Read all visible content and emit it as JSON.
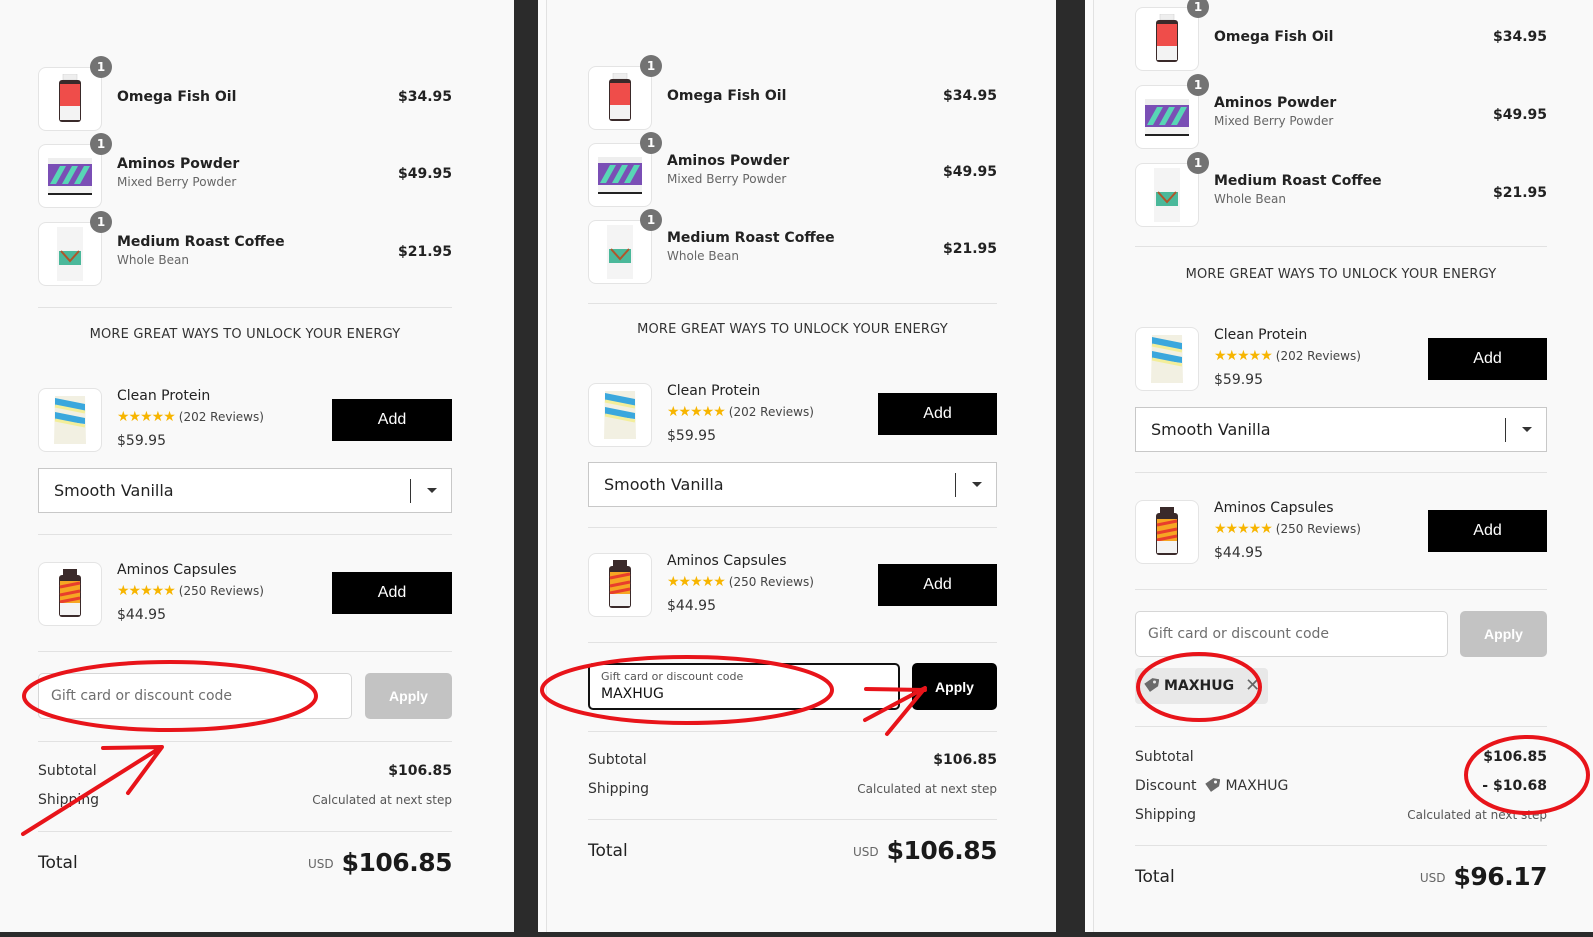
{
  "steps": [
    {
      "line_items": [
        {
          "name": "Omega Fish Oil",
          "variant": "",
          "price": "$34.95",
          "quantity": "1",
          "image": "red-bottle"
        },
        {
          "name": "Aminos Powder",
          "variant": "Mixed Berry Powder",
          "price": "$49.95",
          "quantity": "1",
          "image": "purple-teal-tub"
        },
        {
          "name": "Medium Roast Coffee",
          "variant": "Whole Bean",
          "price": "$21.95",
          "quantity": "1",
          "image": "white-coffee-bag"
        }
      ],
      "upsell_heading": "MORE GREAT WAYS TO UNLOCK YOUR ENERGY",
      "upsells": [
        {
          "name": "Clean Protein",
          "stars": "★★★★★",
          "rating": 5,
          "reviews": "(202 Reviews)",
          "price": "$59.95",
          "button": "Add",
          "variant_select": "Smooth Vanilla",
          "image": "blue-yellow-pouch"
        },
        {
          "name": "Aminos Capsules",
          "stars": "★★★★★",
          "rating": 5,
          "reviews": "(250 Reviews)",
          "price": "$44.95",
          "button": "Add",
          "image": "orange-bottle"
        }
      ],
      "discount": {
        "placeholder": "Gift card or discount code",
        "value": "",
        "apply_label": "Apply",
        "apply_state": "disabled"
      },
      "summary": {
        "subtotal_label": "Subtotal",
        "subtotal": "$106.85",
        "shipping_label": "Shipping",
        "shipping": "Calculated at next step",
        "total_label": "Total",
        "currency": "USD",
        "total": "$106.85"
      }
    },
    {
      "line_items": [
        {
          "name": "Omega Fish Oil",
          "variant": "",
          "price": "$34.95",
          "quantity": "1",
          "image": "red-bottle"
        },
        {
          "name": "Aminos Powder",
          "variant": "Mixed Berry Powder",
          "price": "$49.95",
          "quantity": "1",
          "image": "purple-teal-tub"
        },
        {
          "name": "Medium Roast Coffee",
          "variant": "Whole Bean",
          "price": "$21.95",
          "quantity": "1",
          "image": "white-coffee-bag"
        }
      ],
      "upsell_heading": "MORE GREAT WAYS TO UNLOCK YOUR ENERGY",
      "upsells": [
        {
          "name": "Clean Protein",
          "stars": "★★★★★",
          "rating": 5,
          "reviews": "(202 Reviews)",
          "price": "$59.95",
          "button": "Add",
          "variant_select": "Smooth Vanilla",
          "image": "blue-yellow-pouch"
        },
        {
          "name": "Aminos Capsules",
          "stars": "★★★★★",
          "rating": 5,
          "reviews": "(250 Reviews)",
          "price": "$44.95",
          "button": "Add",
          "image": "orange-bottle"
        }
      ],
      "discount": {
        "placeholder": "Gift card or discount code",
        "value": "MAXHUG",
        "apply_label": "Apply",
        "apply_state": "active"
      },
      "summary": {
        "subtotal_label": "Subtotal",
        "subtotal": "$106.85",
        "shipping_label": "Shipping",
        "shipping": "Calculated at next step",
        "total_label": "Total",
        "currency": "USD",
        "total": "$106.85"
      }
    },
    {
      "line_items": [
        {
          "name": "Omega Fish Oil",
          "variant": "",
          "price": "$34.95",
          "quantity": "1",
          "image": "red-bottle"
        },
        {
          "name": "Aminos Powder",
          "variant": "Mixed Berry Powder",
          "price": "$49.95",
          "quantity": "1",
          "image": "purple-teal-tub"
        },
        {
          "name": "Medium Roast Coffee",
          "variant": "Whole Bean",
          "price": "$21.95",
          "quantity": "1",
          "image": "white-coffee-bag"
        }
      ],
      "upsell_heading": "MORE GREAT WAYS TO UNLOCK YOUR ENERGY",
      "upsells": [
        {
          "name": "Clean Protein",
          "stars": "★★★★★",
          "rating": 5,
          "reviews": "(202 Reviews)",
          "price": "$59.95",
          "button": "Add",
          "variant_select": "Smooth Vanilla",
          "image": "blue-yellow-pouch"
        },
        {
          "name": "Aminos Capsules",
          "stars": "★★★★★",
          "rating": 5,
          "reviews": "(250 Reviews)",
          "price": "$44.95",
          "button": "Add",
          "image": "orange-bottle"
        }
      ],
      "discount": {
        "placeholder": "Gift card or discount code",
        "value": "",
        "apply_label": "Apply",
        "apply_state": "disabled",
        "applied_code": "MAXHUG",
        "remove_icon": "close-icon",
        "tag_icon": "tag-icon"
      },
      "summary": {
        "subtotal_label": "Subtotal",
        "subtotal": "$106.85",
        "discount_label": "Discount",
        "discount_code": "MAXHUG",
        "discount_amount": "- $10.68",
        "shipping_label": "Shipping",
        "shipping": "Calculated at next step",
        "total_label": "Total",
        "currency": "USD",
        "total": "$96.17"
      }
    }
  ],
  "annotation_color": "#e8141a"
}
